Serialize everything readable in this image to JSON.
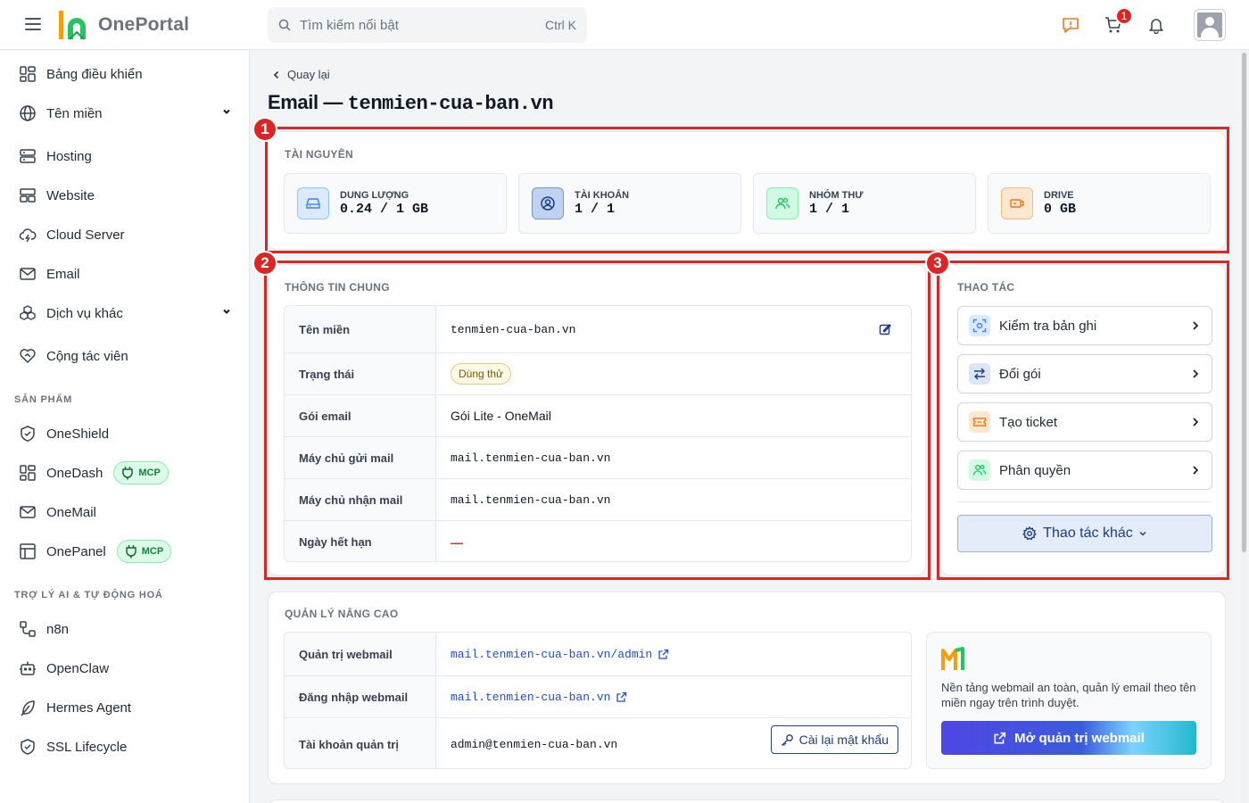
{
  "topbar": {
    "brand": "OnePortal",
    "search_placeholder": "Tìm kiếm nổi bật",
    "search_shortcut": "Ctrl K",
    "cart_count": "1"
  },
  "sidebar": {
    "items": [
      {
        "label": "Bảng điều khiển",
        "icon": "dashboard-icon"
      },
      {
        "label": "Tên miền",
        "icon": "globe-icon"
      },
      {
        "label": "Hosting",
        "icon": "server-icon"
      },
      {
        "label": "Website",
        "icon": "website-icon"
      },
      {
        "label": "Cloud Server",
        "icon": "cloud-icon"
      },
      {
        "label": "Email",
        "icon": "mail-icon"
      },
      {
        "label": "Dịch vụ khác",
        "icon": "boxes-icon"
      },
      {
        "label": "Cộng tác viên",
        "icon": "handshake-icon"
      }
    ],
    "section_products": "SẢN PHẨM",
    "products": [
      {
        "label": "OneShield",
        "icon": "shield-icon"
      },
      {
        "label": "OneDash",
        "icon": "dashboard-icon",
        "badge": "MCP"
      },
      {
        "label": "OneMail",
        "icon": "mail-icon"
      },
      {
        "label": "OnePanel",
        "icon": "panel-icon",
        "badge": "MCP"
      }
    ],
    "section_ai": "TRỢ LÝ AI & TỰ ĐỘNG HOÁ",
    "ai": [
      {
        "label": "n8n",
        "icon": "workflow-icon"
      },
      {
        "label": "OpenClaw",
        "icon": "bot-icon"
      },
      {
        "label": "Hermes Agent",
        "icon": "feather-icon"
      },
      {
        "label": "SSL Lifecycle",
        "icon": "shield-check-icon"
      }
    ]
  },
  "main": {
    "back_label": "Quay lại",
    "title_prefix": "Email —",
    "title_domain": "tenmien-cua-ban.vn",
    "resources": {
      "title": "TÀI NGUYÊN",
      "stats": [
        {
          "label": "DUNG LƯỢNG",
          "value": "0.24 / 1 GB",
          "color": "#3b82f6"
        },
        {
          "label": "TÀI KHOẢN",
          "value": "1 / 1",
          "color": "#1e40af"
        },
        {
          "label": "NHÓM THƯ",
          "value": "1 / 1",
          "color": "#22c55e"
        },
        {
          "label": "DRIVE",
          "value": "0 GB",
          "color": "#f97316"
        }
      ]
    },
    "general": {
      "title": "THÔNG TIN CHUNG",
      "rows": [
        {
          "key": "Tên miền",
          "value": "tenmien-cua-ban.vn"
        },
        {
          "key": "Trạng thái",
          "value": "Dùng thử"
        },
        {
          "key": "Gói email",
          "value": "Gói Lite - OneMail"
        },
        {
          "key": "Máy chủ gửi mail",
          "value": "mail.tenmien-cua-ban.vn"
        },
        {
          "key": "Máy chủ nhận mail",
          "value": "mail.tenmien-cua-ban.vn"
        },
        {
          "key": "Ngày hết hạn",
          "value": "—"
        }
      ]
    },
    "actions": {
      "title": "THAO TÁC",
      "items": [
        {
          "label": "Kiểm tra bản ghi",
          "icon": "scan-icon"
        },
        {
          "label": "Đổi gói",
          "icon": "swap-icon"
        },
        {
          "label": "Tạo ticket",
          "icon": "ticket-icon"
        },
        {
          "label": "Phân quyền",
          "icon": "users-icon"
        }
      ],
      "more_label": "Thao tác khác"
    },
    "advanced": {
      "title": "QUẢN LÝ NÂNG CAO",
      "rows": [
        {
          "key": "Quản trị webmail",
          "value": "mail.tenmien-cua-ban.vn/admin"
        },
        {
          "key": "Đăng nhập webmail",
          "value": "mail.tenmien-cua-ban.vn"
        },
        {
          "key": "Tài khoản quản trị",
          "value": "admin@tenmien-cua-ban.vn"
        }
      ],
      "reset_label": "Cài lại mật khẩu",
      "promo_text": "Nền tảng webmail an toàn, quản lý email theo tên miền ngay trên trình duyệt.",
      "promo_button": "Mở quản trị webmail"
    },
    "markers": [
      "1",
      "2",
      "3"
    ]
  }
}
